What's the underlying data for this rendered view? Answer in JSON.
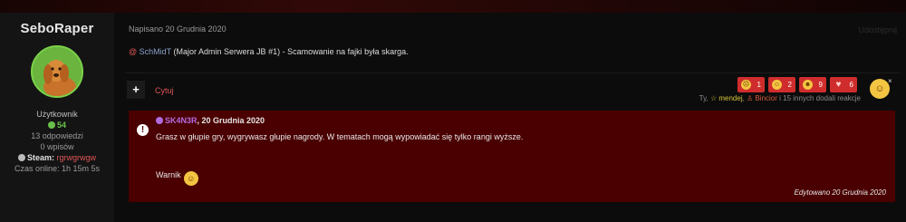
{
  "author": {
    "name": "SeboRaper",
    "role": "Użytkownik",
    "reputation": "54",
    "replies": "13 odpowiedzi",
    "warnings": "0 wpisów",
    "steam_label": "Steam:",
    "steam_value": "rgrwgrwgw",
    "online_time": "Czas online: 1h 15m 5s"
  },
  "post": {
    "date": "Napisano 20 Grudnia 2020",
    "share_label": "Udostępnij",
    "mention_at": "@",
    "mention_user": "SchMidT",
    "body_rest": "(Major Admin Serwera JB #1) - Scamowanie na fajki była skarga.",
    "add_label": "+",
    "quote_label": "Cytuj"
  },
  "reactions": {
    "items": [
      {
        "icon": "sad-face-icon",
        "count": "1"
      },
      {
        "icon": "laugh-face-icon",
        "count": "2"
      },
      {
        "icon": "grin-face-icon",
        "count": "9"
      },
      {
        "icon": "heart-icon",
        "count": "6"
      }
    ],
    "summary_prefix": "Ty,",
    "summary_user1": "mendej",
    "summary_user2": "Bincior",
    "summary_suffix": "i 15 innych dodali reakcje"
  },
  "moderator_notice": {
    "mod_name": "SK4N3R",
    "mod_date": ", 20 Grudnia 2020",
    "text": "Grasz w głupie gry, wygrywasz głupie nagrody. W tematach mogą wypowiadać się tylko rangi wyższe.",
    "warning_label": "Warnik",
    "edited": "Edytowano 20 Grudnia 2020"
  },
  "colors": {
    "accent_red": "#cf2d2d",
    "notice_bg": "#4a0000",
    "reputation_green": "#69c04a",
    "moderator_purple": "#b26ae0"
  }
}
